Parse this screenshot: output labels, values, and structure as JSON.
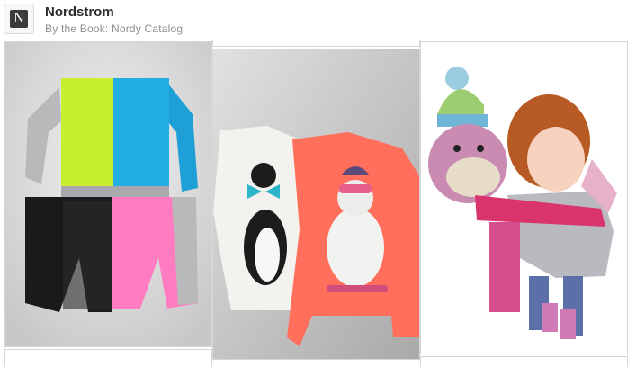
{
  "board": {
    "owner": "Nordstrom",
    "name": "By the Book: Nordy Catalog",
    "logo_letter": "N",
    "icon": "nordstrom-logo"
  },
  "pins": [
    {
      "label": "color-block sequin sweatshirt and shorts"
    },
    {
      "label": "penguin and polar bear graphic sweatshirts"
    },
    {
      "label": "girl hugging sock monkey"
    }
  ],
  "colors": {
    "accent": "#2b2b2b",
    "muted": "#8c8c8c",
    "border": "#d6d6d6"
  }
}
